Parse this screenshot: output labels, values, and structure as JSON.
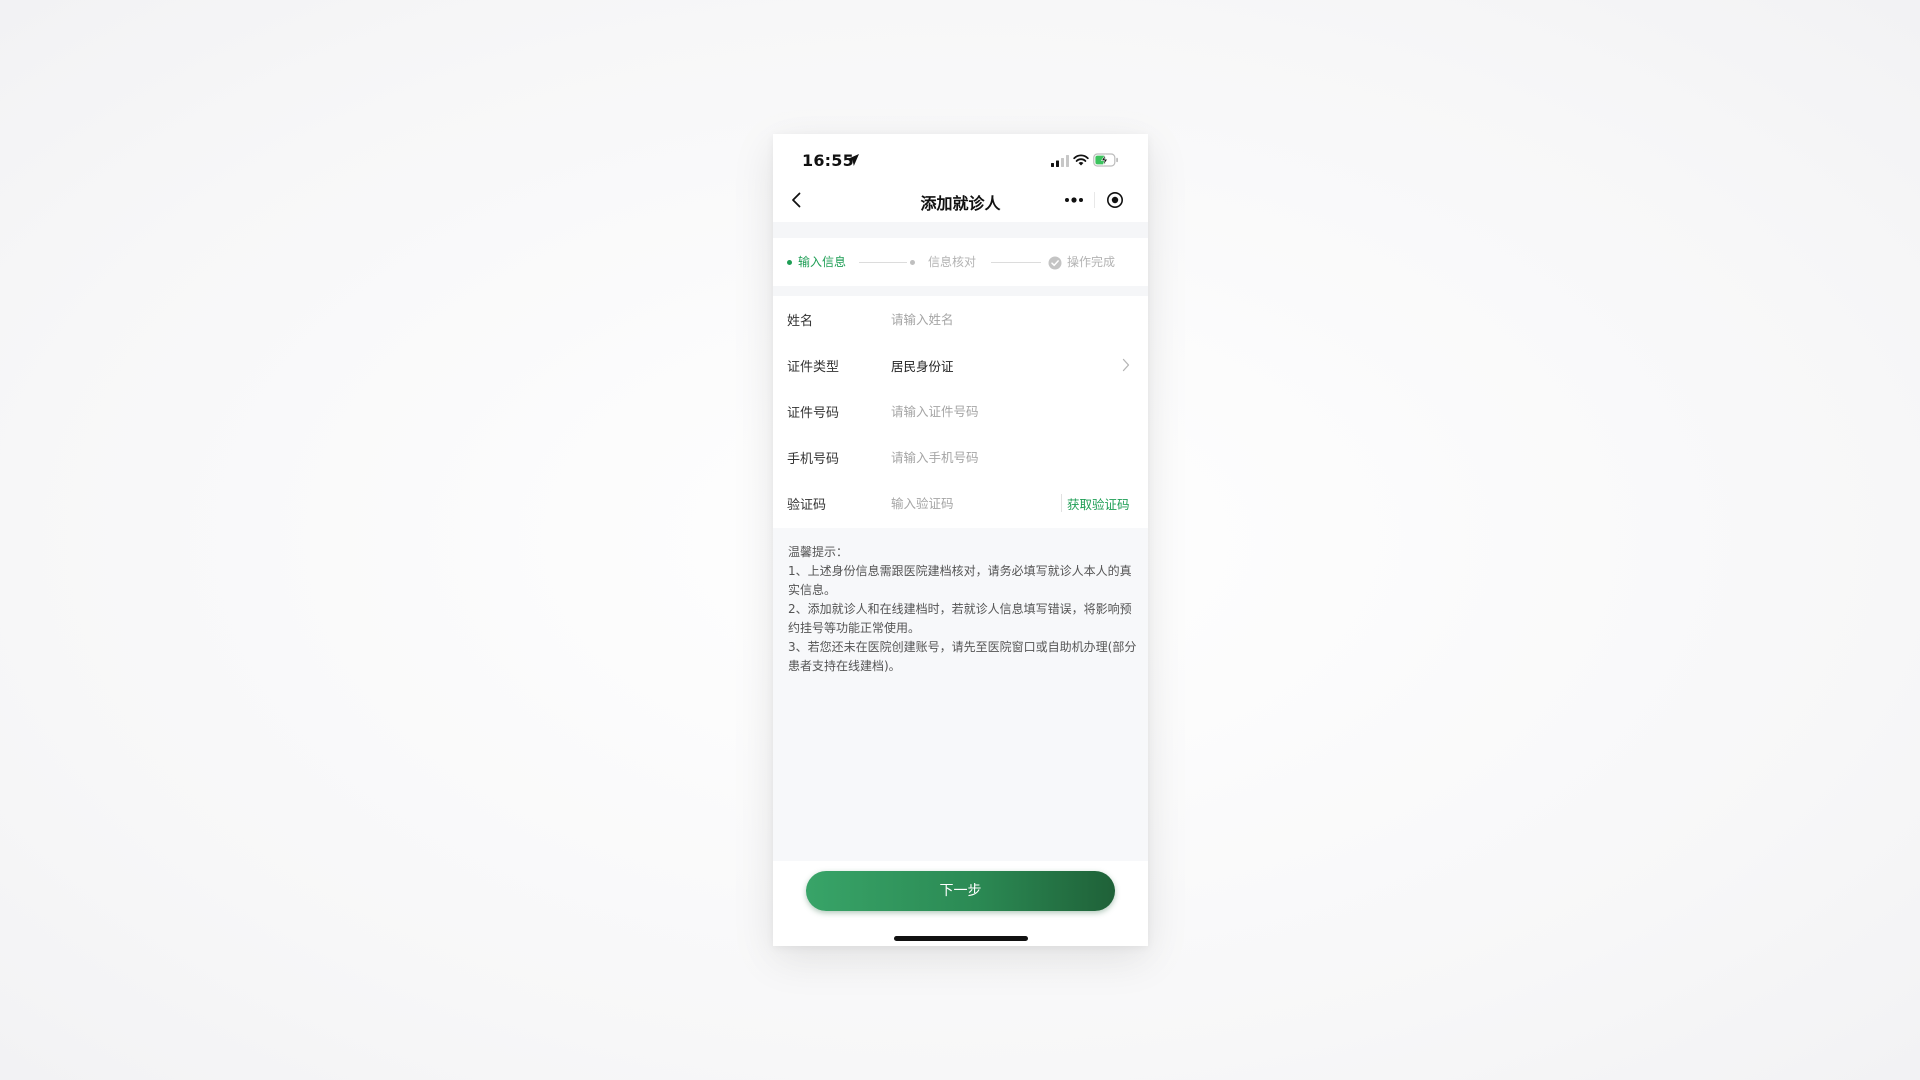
{
  "status_bar": {
    "time": "16:55"
  },
  "nav": {
    "title": "添加就诊人"
  },
  "steps": [
    {
      "label": "输入信息",
      "state": "active"
    },
    {
      "label": "信息核对",
      "state": "pending"
    },
    {
      "label": "操作完成",
      "state": "pending"
    }
  ],
  "form": {
    "name": {
      "label": "姓名",
      "placeholder": "请输入姓名"
    },
    "id_type": {
      "label": "证件类型",
      "value": "居民身份证"
    },
    "id_number": {
      "label": "证件号码",
      "placeholder": "请输入证件号码"
    },
    "phone": {
      "label": "手机号码",
      "placeholder": "请输入手机号码"
    },
    "code": {
      "label": "验证码",
      "placeholder": "输入验证码",
      "button": "获取验证码"
    }
  },
  "tips": {
    "title": "温馨提示：",
    "items": [
      "1、上述身份信息需跟医院建档核对，请务必填写就诊人本人的真实信息。",
      "2、添加就诊人和在线建档时，若就诊人信息填写错误，将影响预约挂号等功能正常使用。",
      "3、若您还未在医院创建账号，请先至医院窗口或自助机办理(部分患者支持在线建档)。"
    ]
  },
  "footer": {
    "next_label": "下一步"
  },
  "colors": {
    "accent": "#1e9e55",
    "button_gradient_start": "#38a468",
    "button_gradient_end": "#1f6138",
    "muted_text": "#a5a5a5",
    "tips_background": "#f7f8fa"
  }
}
